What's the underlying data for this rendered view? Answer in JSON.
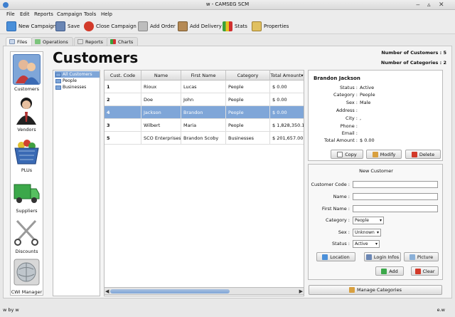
{
  "window": {
    "title": "w - CAMSEG SCM",
    "min": "‒",
    "max": "▵",
    "close": "✕"
  },
  "menu": [
    "File",
    "Edit",
    "Reports",
    "Campaign",
    "Tools",
    "Help"
  ],
  "toolbar": {
    "new_campaign": "New Campaign",
    "save": "Save",
    "close_campaign": "Close Campaign",
    "add_order": "Add Order",
    "add_delivery": "Add Delivery",
    "stats": "Stats",
    "properties": "Properties"
  },
  "tabs": [
    "Files",
    "Operations",
    "Reports",
    "Charts"
  ],
  "nav": [
    "Customers",
    "Vendors",
    "PLUs",
    "Suppliers",
    "Discounts",
    "CWI Manager"
  ],
  "page_title": "Customers",
  "counts": {
    "customers_label": "Number of Customers : 5",
    "categories_label": "Number of Categories : 2"
  },
  "tree": [
    "All Customers",
    "People",
    "Businesses"
  ],
  "table": {
    "columns": [
      "Cust. Code",
      "Name",
      "First Name",
      "Category",
      "Total Amount"
    ],
    "sort_indicator": "▾",
    "rows": [
      [
        "1",
        "Rioux",
        "Lucas",
        "People",
        "$ 0.00"
      ],
      [
        "2",
        "Doe",
        "John",
        "People",
        "$ 0.00"
      ],
      [
        "4",
        "Jackson",
        "Brandon",
        "People",
        "$ 0.00"
      ],
      [
        "3",
        "Wilbert",
        "Maria",
        "People",
        "$ 1,828,350.12"
      ],
      [
        "5",
        "SCO Enterprises",
        "Brandon Scoby",
        "Businesses",
        "$ 201,657.00"
      ]
    ],
    "selected_row": 2
  },
  "details": {
    "name": "Brandon Jackson",
    "fields": [
      {
        "label": "Status :",
        "value": "Active"
      },
      {
        "label": "Category :",
        "value": "People"
      },
      {
        "label": "Sex :",
        "value": "Male"
      },
      {
        "label": "Address :",
        "value": ""
      },
      {
        "label": "City :",
        "value": ","
      },
      {
        "label": "Phone :",
        "value": ""
      },
      {
        "label": "Email :",
        "value": ""
      },
      {
        "label": "Total Amount :",
        "value": "$ 0.00"
      }
    ],
    "copy": "Copy",
    "modify": "Modify",
    "delete": "Delete"
  },
  "new_customer": {
    "title": "New Customer",
    "code_label": "Customer Code :",
    "name_label": "Name :",
    "first_name_label": "First Name :",
    "category_label": "Category :",
    "category_value": "People",
    "sex_label": "Sex :",
    "sex_value": "Unknown",
    "status_label": "Status :",
    "status_value": "Active",
    "location": "Location",
    "login_infos": "Login Infos",
    "picture": "Picture",
    "add": "Add",
    "clear": "Clear"
  },
  "manage_categories": "Manage Categories",
  "status": {
    "left": "w by w",
    "right": "e.w"
  },
  "colors": {
    "selection": "#7fa6d8",
    "accent": "#4b78b8"
  }
}
